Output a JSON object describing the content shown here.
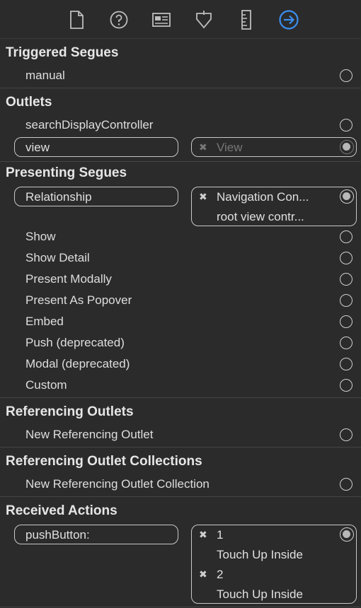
{
  "toolbar": {
    "icons": [
      "file-icon",
      "help-icon",
      "identity-icon",
      "attributes-icon",
      "size-icon",
      "connections-icon"
    ],
    "accent": "#3b8ef0"
  },
  "triggered_segues": {
    "title": "Triggered Segues",
    "items": [
      "manual"
    ]
  },
  "outlets": {
    "title": "Outlets",
    "items": [
      "searchDisplayController"
    ],
    "view_outlet": {
      "label": "view",
      "target": "View"
    }
  },
  "presenting_segues": {
    "title": "Presenting Segues",
    "relationship": {
      "label": "Relationship",
      "target_line1": "Navigation Con...",
      "target_line2": "root view contr..."
    },
    "items": [
      "Show",
      "Show Detail",
      "Present Modally",
      "Present As Popover",
      "Embed",
      "Push (deprecated)",
      "Modal (deprecated)",
      "Custom"
    ]
  },
  "referencing_outlets": {
    "title": "Referencing Outlets",
    "items": [
      "New Referencing Outlet"
    ]
  },
  "referencing_outlet_collections": {
    "title": "Referencing Outlet Collections",
    "items": [
      "New Referencing Outlet Collection"
    ]
  },
  "received_actions": {
    "title": "Received Actions",
    "action": {
      "label": "pushButton:",
      "connections": [
        {
          "index": "1",
          "event": "Touch Up Inside"
        },
        {
          "index": "2",
          "event": "Touch Up Inside"
        }
      ]
    }
  }
}
